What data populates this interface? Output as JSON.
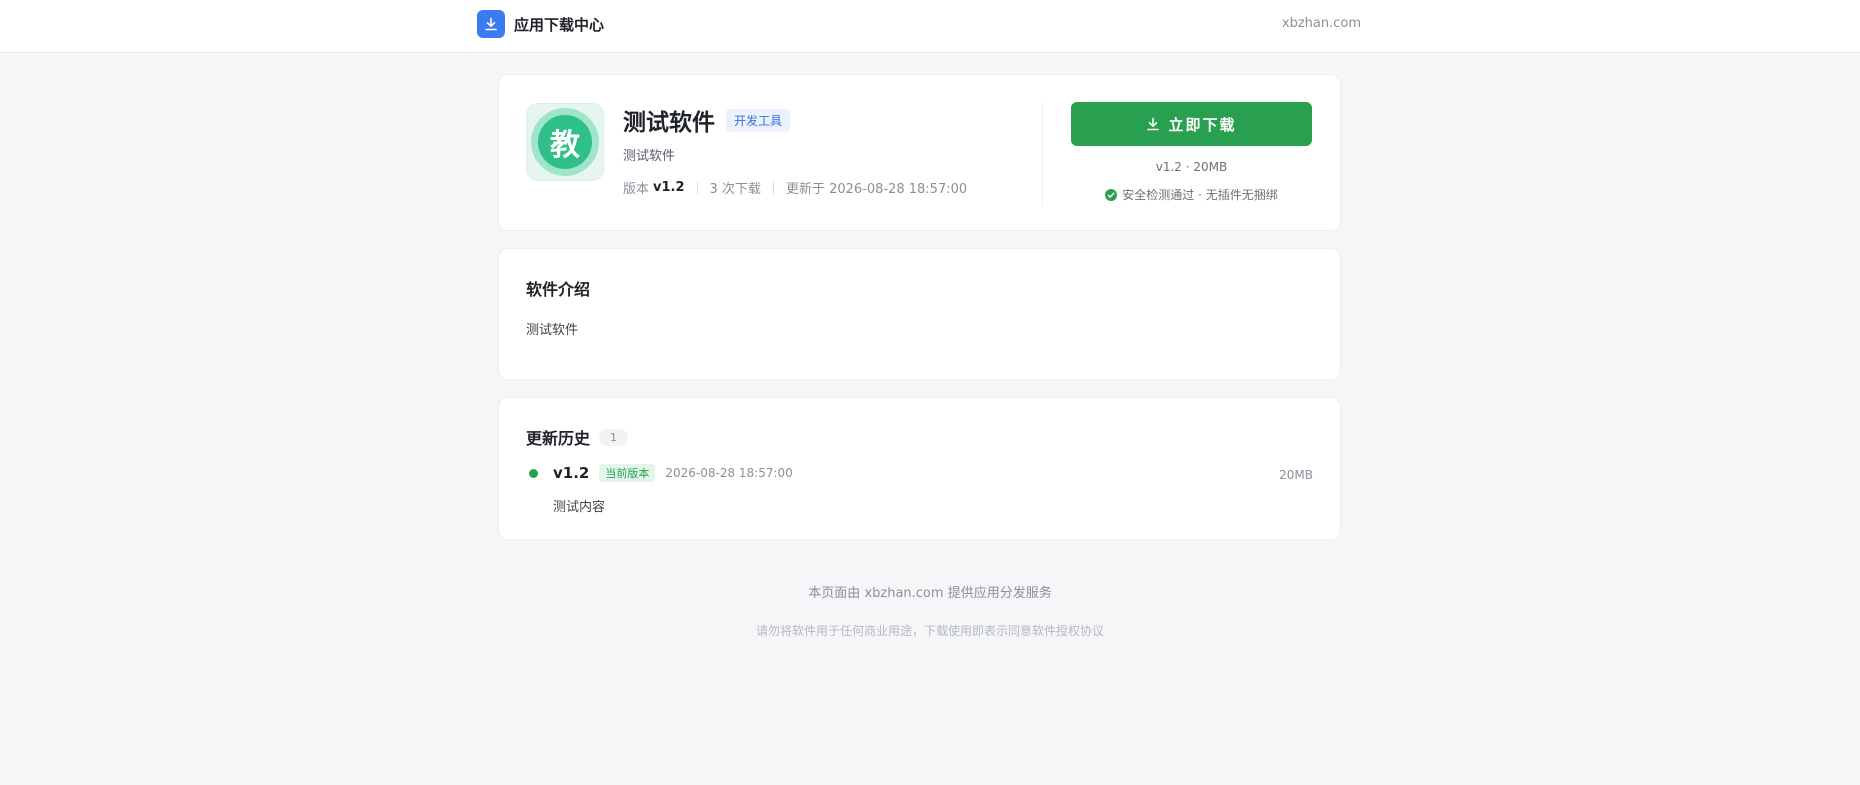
{
  "header": {
    "brand_icon": "download-icon",
    "brand_name": "应用下载中心",
    "site_link": "xbzhan.com"
  },
  "app": {
    "icon_glyph": "教",
    "title": "测试软件",
    "category": "开发工具",
    "subtitle": "测试软件",
    "version_label": "版本",
    "version": "v1.2",
    "downloads": "3 次下载",
    "updated": "更新于 2026-08-28 18:57:00",
    "download_button": "立即下载",
    "version_size": "v1.2 · 20MB",
    "safe_text": "安全检测通过 · 无插件无捆绑"
  },
  "intro": {
    "title": "软件介绍",
    "text": "测试软件"
  },
  "history": {
    "title": "更新历史",
    "count": "1",
    "items": [
      {
        "version": "v1.2",
        "tag": "当前版本",
        "date": "2026-08-28 18:57:00",
        "size": "20MB",
        "content": "测试内容"
      }
    ]
  },
  "footer": {
    "line1_prefix": "本页面由",
    "line1_link": "xbzhan.com",
    "line1_suffix": "提供应用分发服务",
    "line2": "请勿将软件用于任何商业用途，下载使用即表示同意软件授权协议"
  },
  "colors": {
    "accent_green": "#28a04f",
    "brand_blue": "#3a7bf3",
    "background": "#f5f6f8"
  }
}
